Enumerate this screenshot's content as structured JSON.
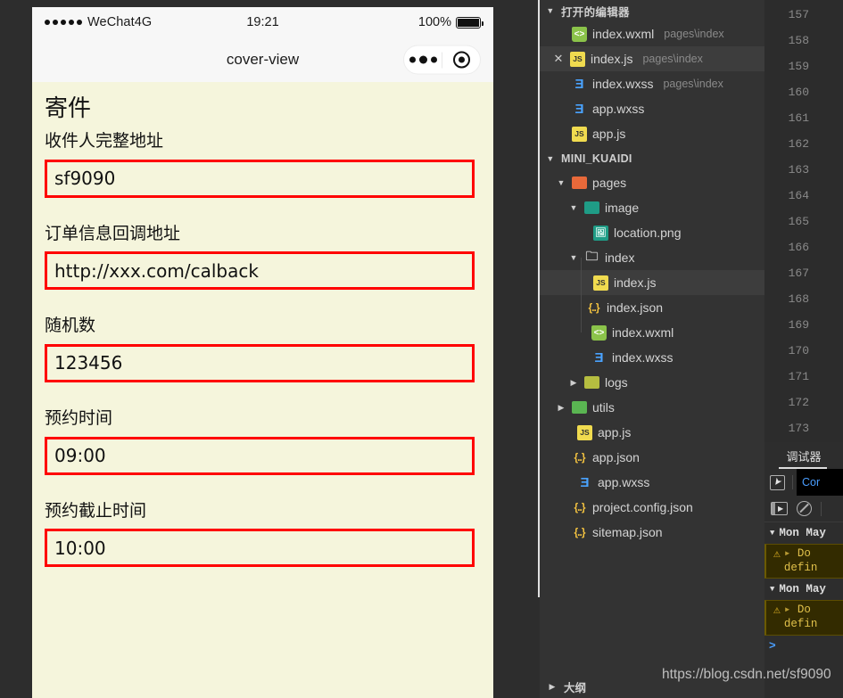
{
  "simulator": {
    "status_bar": {
      "carrier": "WeChat4G",
      "time": "19:21",
      "battery_percent": "100%"
    },
    "nav": {
      "title": "cover-view"
    },
    "page": {
      "heading": "寄件",
      "fields": [
        {
          "label": "收件人完整地址",
          "value": "sf9090"
        },
        {
          "label": "订单信息回调地址",
          "value": "http://xxx.com/calback"
        },
        {
          "label": "随机数",
          "value": "123456"
        },
        {
          "label": "预约时间",
          "value": "09:00"
        },
        {
          "label": "预约截止时间",
          "value": "10:00"
        }
      ]
    }
  },
  "explorer": {
    "open_editors": {
      "title": "打开的编辑器",
      "items": [
        {
          "name": "index.wxml",
          "path": "pages\\index",
          "icon": "wxml-file-icon",
          "selected": false,
          "closable": false
        },
        {
          "name": "index.js",
          "path": "pages\\index",
          "icon": "js-file-icon",
          "selected": true,
          "closable": true
        },
        {
          "name": "index.wxss",
          "path": "pages\\index",
          "icon": "wxss-file-icon",
          "selected": false,
          "closable": false
        },
        {
          "name": "app.wxss",
          "path": "",
          "icon": "wxss-file-icon",
          "selected": false,
          "closable": false
        },
        {
          "name": "app.js",
          "path": "",
          "icon": "js-file-icon",
          "selected": false,
          "closable": false
        }
      ]
    },
    "project": {
      "title": "MINI_KUAIDI",
      "items": [
        {
          "name": "pages",
          "type": "folder",
          "icon": "folder-orange-icon",
          "depth": 1,
          "expanded": true,
          "selected": false
        },
        {
          "name": "image",
          "type": "folder",
          "icon": "folder-teal-icon",
          "depth": 2,
          "expanded": true,
          "selected": false
        },
        {
          "name": "location.png",
          "type": "file",
          "icon": "image-file-icon",
          "depth": 3,
          "selected": false
        },
        {
          "name": "index",
          "type": "folder",
          "icon": "folder-plain-icon",
          "depth": 2,
          "expanded": true,
          "selected": false
        },
        {
          "name": "index.js",
          "type": "file",
          "icon": "js-file-icon",
          "depth": 3,
          "selected": true
        },
        {
          "name": "index.json",
          "type": "file",
          "icon": "json-file-icon",
          "depth": 3,
          "selected": false
        },
        {
          "name": "index.wxml",
          "type": "file",
          "icon": "wxml-file-icon",
          "depth": 3,
          "selected": false
        },
        {
          "name": "index.wxss",
          "type": "file",
          "icon": "wxss-file-icon",
          "depth": 3,
          "selected": false
        },
        {
          "name": "logs",
          "type": "folder",
          "icon": "folder-olive-icon",
          "depth": 2,
          "expanded": false,
          "selected": false
        },
        {
          "name": "utils",
          "type": "folder",
          "icon": "folder-green-icon",
          "depth": 1,
          "expanded": false,
          "selected": false
        },
        {
          "name": "app.js",
          "type": "file",
          "icon": "js-file-icon",
          "depth": 2,
          "selected": false
        },
        {
          "name": "app.json",
          "type": "file",
          "icon": "json-file-icon",
          "depth": 2,
          "selected": false
        },
        {
          "name": "app.wxss",
          "type": "file",
          "icon": "wxss-file-icon",
          "depth": 2,
          "selected": false
        },
        {
          "name": "project.config.json",
          "type": "file",
          "icon": "json-file-icon",
          "depth": 2,
          "selected": false
        },
        {
          "name": "sitemap.json",
          "type": "file",
          "icon": "json-file-icon",
          "depth": 2,
          "selected": false
        }
      ]
    },
    "outline": {
      "title": "大纲"
    }
  },
  "editor": {
    "line_numbers": [
      "157",
      "158",
      "159",
      "160",
      "161",
      "162",
      "163",
      "164",
      "165",
      "166",
      "167",
      "168",
      "169",
      "170",
      "171",
      "172",
      "173"
    ]
  },
  "debugger": {
    "tab_label": "调试器",
    "console_tab": "Cor",
    "logs": [
      {
        "group": "Mon May",
        "warning_line1": "Do",
        "warning_line2": "defin"
      },
      {
        "group": "Mon May",
        "warning_line1": "Do",
        "warning_line2": "defin"
      }
    ],
    "prompt": ">"
  },
  "watermark": "https://blog.csdn.net/sf9090",
  "colors": {
    "page_background": "#f5f5dc",
    "input_border": "#ff0000",
    "explorer_background": "#333333",
    "selected_row": "#3d3d3d",
    "warning_yellow": "#e8b923",
    "accent_blue": "#4a9eff"
  }
}
